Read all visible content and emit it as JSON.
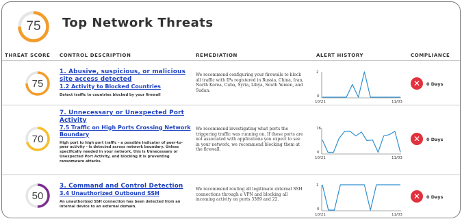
{
  "header": {
    "score": "75",
    "score_value": 75,
    "title": "Top Network Threats",
    "ring_color": "#f39c2a"
  },
  "columns": {
    "threat_score": "THREAT SCORE",
    "control_description": "CONTROL DESCRIPTION",
    "remediation": "REMEDIATION",
    "alert_history": "ALERT HISTORY",
    "compliance": "COMPLIANCE"
  },
  "threats": [
    {
      "score": "75",
      "score_value": 75,
      "ring_color": "#f39c2a",
      "control_title": "1. Abusive, suspicious, or malicious site access detected",
      "sub_title": "1.2 Activity to Blocked Countries",
      "description": "Detect traffic to countries blocked by your firewall",
      "remediation": "We recommend configuring your firewalls to block all traffic with IPs registered in Russia, China, Iran, North Korea, Cuba, Syria, Libya, South Yemen, and Sudan.",
      "alert_history": {
        "y_max": "2",
        "y_min": "0",
        "x_start": "10/21",
        "x_end": "11/03",
        "values": [
          0,
          0,
          0,
          0,
          0,
          1,
          0,
          2,
          0,
          0,
          0,
          0,
          0,
          0
        ]
      },
      "compliance": {
        "icon": "x-circle-icon",
        "color": "#e2303c",
        "label": "0 Days"
      }
    },
    {
      "score": "70",
      "score_value": 70,
      "ring_color": "#f7bd2a",
      "control_title": "7. Unnecessary or Unexpected Port Activity",
      "sub_title": "7.5 Traffic on High Ports Crossing Network Boundary",
      "description": "High port to high port traffic - a possible indicator of peer-to-peer activity - is detected across network boundary. Unless specifically needed in your network, this is Unnecessary or Unexpected Port Activity, and blocking it is preventing ransomware attacks.",
      "remediation": "We recommend investigating what ports the triggering traffic was running on. If these ports are not associated with applications you expect to see in your network, we recommend blocking them at the firewall.",
      "alert_history": {
        "y_max": "76",
        "y_min": "0",
        "x_start": "10/21",
        "x_end": "11/03",
        "values": [
          40,
          3,
          3,
          45,
          66,
          66,
          52,
          64,
          38,
          40,
          3,
          52,
          56,
          66,
          3
        ]
      },
      "compliance": {
        "icon": "x-circle-icon",
        "color": "#e2303c",
        "label": "0 Days"
      }
    },
    {
      "score": "50",
      "score_value": 50,
      "ring_color": "#7b2d8e",
      "control_title": "3. Command and Control Detection",
      "sub_title": "3.4 Unauthorized Outbound SSH",
      "description": "An unauthorized SSH connection has been detected from an internal device to an external domain.",
      "remediation": "We recommend routing all legitimate external SSH connections through a VPN and blocking all incoming activity on ports 3389 and 22.",
      "alert_history": {
        "y_max": "1",
        "y_min": "0",
        "x_start": "10/21",
        "x_end": "11/03",
        "values": [
          1,
          0,
          0,
          1,
          1,
          1,
          1,
          1,
          0,
          1,
          1,
          1,
          1,
          1
        ]
      },
      "compliance": {
        "icon": "x-circle-icon",
        "color": "#e2303c",
        "label": "0 Days"
      }
    }
  ]
}
